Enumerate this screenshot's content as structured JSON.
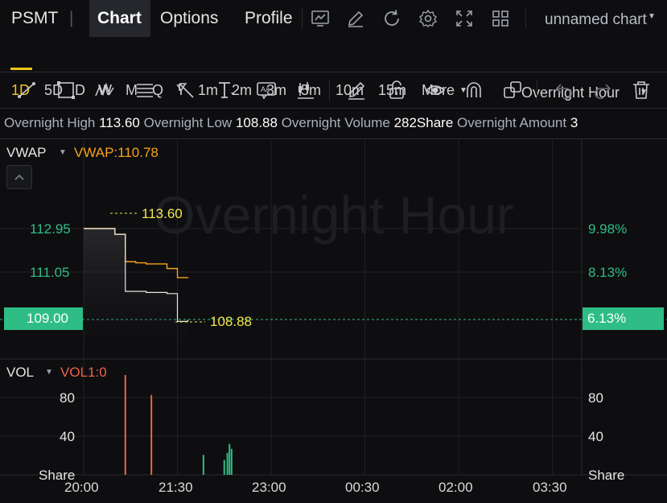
{
  "header": {
    "symbol": "PSMT",
    "divider": "|",
    "tabs": [
      "Chart",
      "Options",
      "Profile"
    ],
    "chart_name": "unnamed chart",
    "icons": [
      "screenshot-icon",
      "edit-icon",
      "refresh-icon",
      "settings-icon",
      "fullscreen-icon",
      "layout-grid-icon"
    ]
  },
  "intervals": {
    "items": [
      "1D",
      "5D",
      "D",
      "W",
      "M",
      "Q",
      "Y",
      "1m",
      "2m",
      "3m",
      "5m",
      "10m",
      "15m"
    ],
    "more_label": "More",
    "session_label": "Overnight Hour",
    "active": "1D"
  },
  "toolbar_icons": [
    "trend-line-icon",
    "rectangle-icon",
    "pattern-icon",
    "fibonacci-icon",
    "arrow-icon",
    "text-tool-icon",
    "annotation-icon",
    "measure-icon",
    "pencil-icon",
    "lock-icon",
    "eye-icon",
    "magnet-icon",
    "copy-icon",
    "undo-icon",
    "redo-icon",
    "trash-icon"
  ],
  "info": {
    "high_label": "Overnight High",
    "high_value": "113.60",
    "low_label": "Overnight Low",
    "low_value": "108.88",
    "volume_label": "Overnight Volume",
    "volume_value": "282Share",
    "amount_label": "Overnight Amount",
    "amount_value": "3"
  },
  "price_panel": {
    "indicator_label": "VWAP",
    "indicator_value": "VWAP:110.78",
    "watermark": "Overnight Hour",
    "high_marker": "113.60",
    "low_marker": "108.88",
    "y_labels_left": [
      "112.95",
      "111.05",
      "109.00"
    ],
    "y_labels_right": [
      "9.98%",
      "8.13%",
      "6.13%"
    ]
  },
  "volume_panel": {
    "indicator_label": "VOL",
    "indicator_value": "VOL1:0",
    "y_labels": [
      "80",
      "40",
      "Share"
    ]
  },
  "x_labels": [
    "20:00",
    "21:30",
    "23:00",
    "00:30",
    "02:00",
    "03:30"
  ],
  "colors": {
    "accent": "#f0c419",
    "up": "#2ebd85",
    "down": "#f0614a",
    "vwap": "#f7a21b"
  },
  "chart_data": [
    {
      "type": "line",
      "x": [
        "20:00",
        "20:10",
        "20:20",
        "20:30",
        "20:40",
        "20:50",
        "21:00",
        "21:10",
        "21:20",
        "21:30",
        "21:40"
      ],
      "series": [
        {
          "name": "",
          "values": [
            112.95,
            112.95,
            112.95,
            112.7,
            110.2,
            110.2,
            110.15,
            110.15,
            110.1,
            108.88,
            108.95
          ]
        },
        {
          "name": "VWAP",
          "values": [
            112.95,
            112.95,
            112.95,
            112.7,
            111.5,
            111.45,
            111.4,
            111.4,
            111.2,
            110.8,
            110.78
          ]
        }
      ],
      "annotations": [
        "113.60",
        "108.88"
      ],
      "ylim": [
        107.5,
        114.5
      ]
    },
    {
      "type": "bar",
      "x": [
        "20:40",
        "21:05",
        "21:55",
        "22:15",
        "22:18",
        "22:20",
        "22:22"
      ],
      "values": [
        100,
        80,
        20,
        15,
        22,
        31,
        26
      ],
      "colors": [
        "#f0614a",
        "#f0614a",
        "#2ebd85",
        "#2ebd85",
        "#2ebd85",
        "#2ebd85",
        "#2ebd85"
      ],
      "ylim": [
        0,
        100
      ]
    }
  ]
}
